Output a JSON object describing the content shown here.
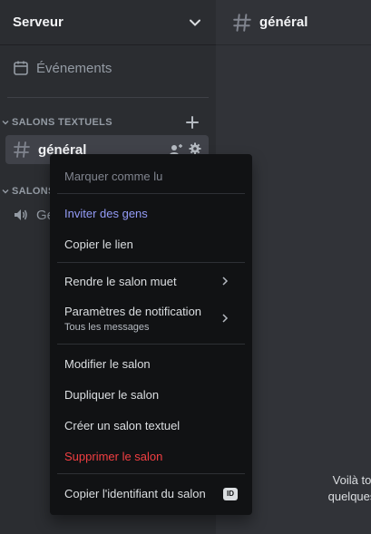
{
  "sidebar": {
    "server_name": "Serveur",
    "events_label": "Événements",
    "categories": {
      "text": "SALONS TEXTUELS",
      "voice": "SALONS"
    },
    "active_channel": "général",
    "voice_channel_partial": "Gé"
  },
  "main": {
    "channel_title": "général",
    "welcome_line1": "Voilà to",
    "welcome_line2": "quelques"
  },
  "context_menu": {
    "mark_read": "Marquer comme lu",
    "invite": "Inviter des gens",
    "copy_link": "Copier le lien",
    "mute": "Rendre le salon muet",
    "notif": "Paramètres de notification",
    "notif_sub": "Tous les messages",
    "edit": "Modifier le salon",
    "duplicate": "Dupliquer le salon",
    "create_text": "Créer un salon textuel",
    "delete": "Supprimer le salon",
    "copy_id": "Copier l'identifiant du salon",
    "id_badge": "ID"
  },
  "colors": {
    "brand": "#949cf7",
    "danger": "#f23f42",
    "sidebar_bg": "#2b2d31",
    "main_bg": "#313338",
    "menu_bg": "#111214"
  }
}
